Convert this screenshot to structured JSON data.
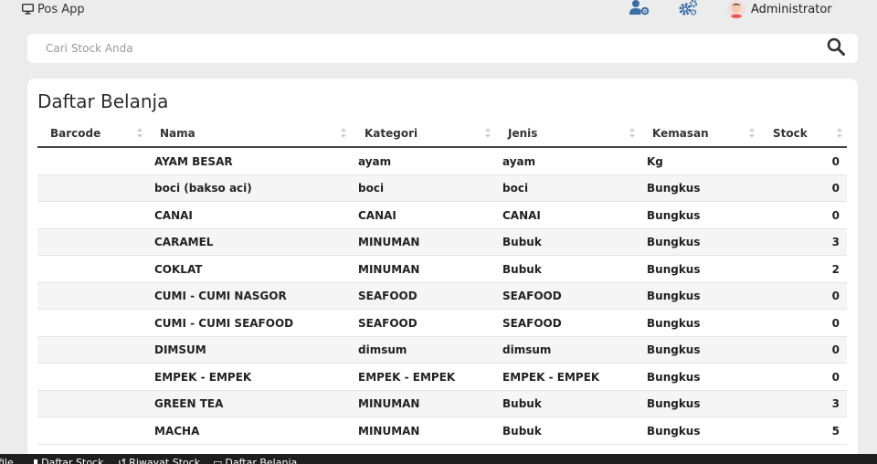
{
  "app": {
    "title": "Pos App"
  },
  "header": {
    "user_name": "Administrator"
  },
  "search": {
    "placeholder": "Cari Stock Anda"
  },
  "main": {
    "title": "Daftar Belanja"
  },
  "table": {
    "columns": [
      "Barcode",
      "Nama",
      "Kategori",
      "Jenis",
      "Kemasan",
      "Stock"
    ],
    "rows": [
      {
        "barcode": "",
        "nama": "AYAM BESAR",
        "kategori": "ayam",
        "jenis": "ayam",
        "kemasan": "Kg",
        "stock": "0"
      },
      {
        "barcode": "",
        "nama": "boci (bakso aci)",
        "kategori": "boci",
        "jenis": "boci",
        "kemasan": "Bungkus",
        "stock": "0"
      },
      {
        "barcode": "",
        "nama": "CANAI",
        "kategori": "CANAI",
        "jenis": "CANAI",
        "kemasan": "Bungkus",
        "stock": "0"
      },
      {
        "barcode": "",
        "nama": "CARAMEL",
        "kategori": "MINUMAN",
        "jenis": "Bubuk",
        "kemasan": "Bungkus",
        "stock": "3"
      },
      {
        "barcode": "",
        "nama": "COKLAT",
        "kategori": "MINUMAN",
        "jenis": "Bubuk",
        "kemasan": "Bungkus",
        "stock": "2"
      },
      {
        "barcode": "",
        "nama": "CUMI - CUMI NASGOR",
        "kategori": "SEAFOOD",
        "jenis": "SEAFOOD",
        "kemasan": "Bungkus",
        "stock": "0"
      },
      {
        "barcode": "",
        "nama": "CUMI - CUMI SEAFOOD",
        "kategori": "SEAFOOD",
        "jenis": "SEAFOOD",
        "kemasan": "Bungkus",
        "stock": "0"
      },
      {
        "barcode": "",
        "nama": "DIMSUM",
        "kategori": "dimsum",
        "jenis": "dimsum",
        "kemasan": "Bungkus",
        "stock": "0"
      },
      {
        "barcode": "",
        "nama": "EMPEK - EMPEK",
        "kategori": "EMPEK - EMPEK",
        "jenis": "EMPEK - EMPEK",
        "kemasan": "Bungkus",
        "stock": "0"
      },
      {
        "barcode": "",
        "nama": "GREEN TEA",
        "kategori": "MINUMAN",
        "jenis": "Bubuk",
        "kemasan": "Bungkus",
        "stock": "3"
      },
      {
        "barcode": "",
        "nama": "MACHA",
        "kategori": "MINUMAN",
        "jenis": "Bubuk",
        "kemasan": "Bungkus",
        "stock": "5"
      }
    ]
  },
  "bottom_nav": {
    "profile_label": "file",
    "daftar_stock_label": "Daftar Stock",
    "riwayat_stock_label": "Riwayat Stock",
    "daftar_belanja_label": "Daftar Belanja"
  },
  "colors": {
    "accent": "#3a6ea5",
    "background": "#ececec",
    "bottom_bar": "#1e1e1e"
  },
  "icons": {
    "brand": "monitor-icon",
    "users": "user-gear-icon",
    "settings": "gears-icon",
    "search": "search-icon"
  }
}
